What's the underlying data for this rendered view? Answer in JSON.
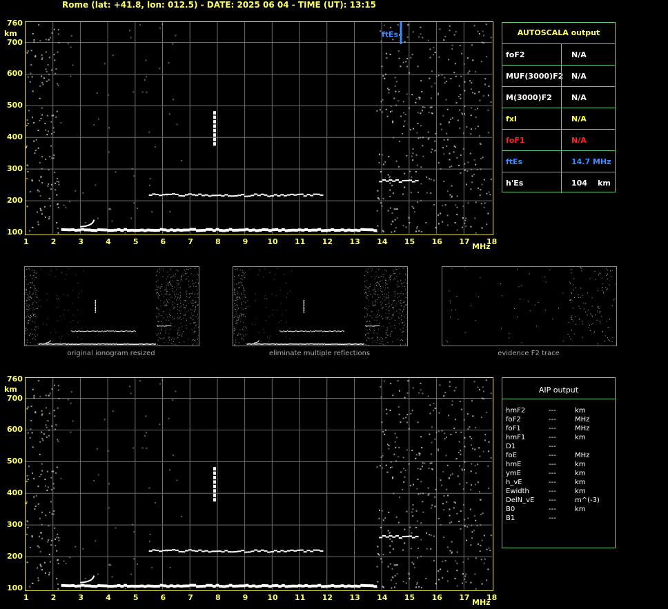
{
  "header": {
    "text": "Rome (lat: +41.8, lon: 012.5) - DATE: 2025 06 04 - TIME (UT): 13:15"
  },
  "plots": {
    "y_unit": "km",
    "x_unit": "MHz",
    "y_ticks": [
      "760",
      "700",
      "600",
      "500",
      "400",
      "300",
      "200",
      "100"
    ],
    "x_ticks": [
      "1",
      "2",
      "3",
      "4",
      "5",
      "6",
      "7",
      "8",
      "9",
      "10",
      "11",
      "12",
      "13",
      "14",
      "15",
      "16",
      "17",
      "18"
    ],
    "ftes_label": "ftEs"
  },
  "autoscala": {
    "title": "AUTOSCALA output",
    "rows": [
      {
        "k": "foF2",
        "v": "N/A",
        "u": "",
        "color": "#ffffff"
      },
      {
        "k": "MUF(3000)F2",
        "v": "N/A",
        "u": "",
        "color": "#ffffff"
      },
      {
        "k": "M(3000)F2",
        "v": "N/A",
        "u": "",
        "color": "#ffffff"
      },
      {
        "k": "fxI",
        "v": "N/A",
        "u": "",
        "color": "#ffff44"
      },
      {
        "k": "foF1",
        "v": "N/A",
        "u": "",
        "color": "#ff2222"
      },
      {
        "k": "ftEs",
        "v": "14.7 MHz",
        "u": "",
        "color": "#3a8fff"
      },
      {
        "k": "h'Es",
        "v": "104",
        "u": "km",
        "color": "#ffffff"
      }
    ]
  },
  "thumbnails": [
    {
      "caption": "original ionogram resized"
    },
    {
      "caption": "eliminate multiple reflections"
    },
    {
      "caption": "evidence F2 trace"
    }
  ],
  "aip": {
    "title": "AIP output",
    "rows": [
      {
        "k": "hmF2",
        "v": "---",
        "u": "km"
      },
      {
        "k": "foF2",
        "v": "---",
        "u": "MHz"
      },
      {
        "k": "foF1",
        "v": "---",
        "u": "MHz"
      },
      {
        "k": "hmF1",
        "v": "---",
        "u": "km"
      },
      {
        "k": "D1",
        "v": "---",
        "u": ""
      },
      {
        "k": "foE",
        "v": "---",
        "u": "MHz"
      },
      {
        "k": "hmE",
        "v": "---",
        "u": "km"
      },
      {
        "k": "ymE",
        "v": "---",
        "u": "km"
      },
      {
        "k": "h_vE",
        "v": "---",
        "u": "km"
      },
      {
        "k": "Ewidth",
        "v": "---",
        "u": "km"
      },
      {
        "k": "DelN_vE",
        "v": "---",
        "u": "m^(-3)"
      },
      {
        "k": "B0",
        "v": "---",
        "u": "km"
      },
      {
        "k": "B1",
        "v": "---",
        "u": ""
      }
    ]
  },
  "colors": {
    "axis": "#e6e03a",
    "grid": "#6f6f6f",
    "trace": "#ffffff",
    "ftes": "#3a8fff",
    "panel": "#5fcf7a"
  },
  "chart_data": {
    "type": "scatter",
    "xlabel": "MHz",
    "ylabel": "km",
    "xlim": [
      1,
      18
    ],
    "ylim": [
      100,
      760
    ],
    "grid": true,
    "ftEs": 14.7,
    "traces": [
      {
        "x_start": 2.3,
        "x_end": 13.8,
        "height": 112
      },
      {
        "x_start": 5.5,
        "x_end": 11.8,
        "height": 220
      },
      {
        "x": 7.85,
        "h_start": 385,
        "h_end": 485
      },
      {
        "x_start": 13.9,
        "x_end": 15.3,
        "height": 265
      }
    ]
  }
}
